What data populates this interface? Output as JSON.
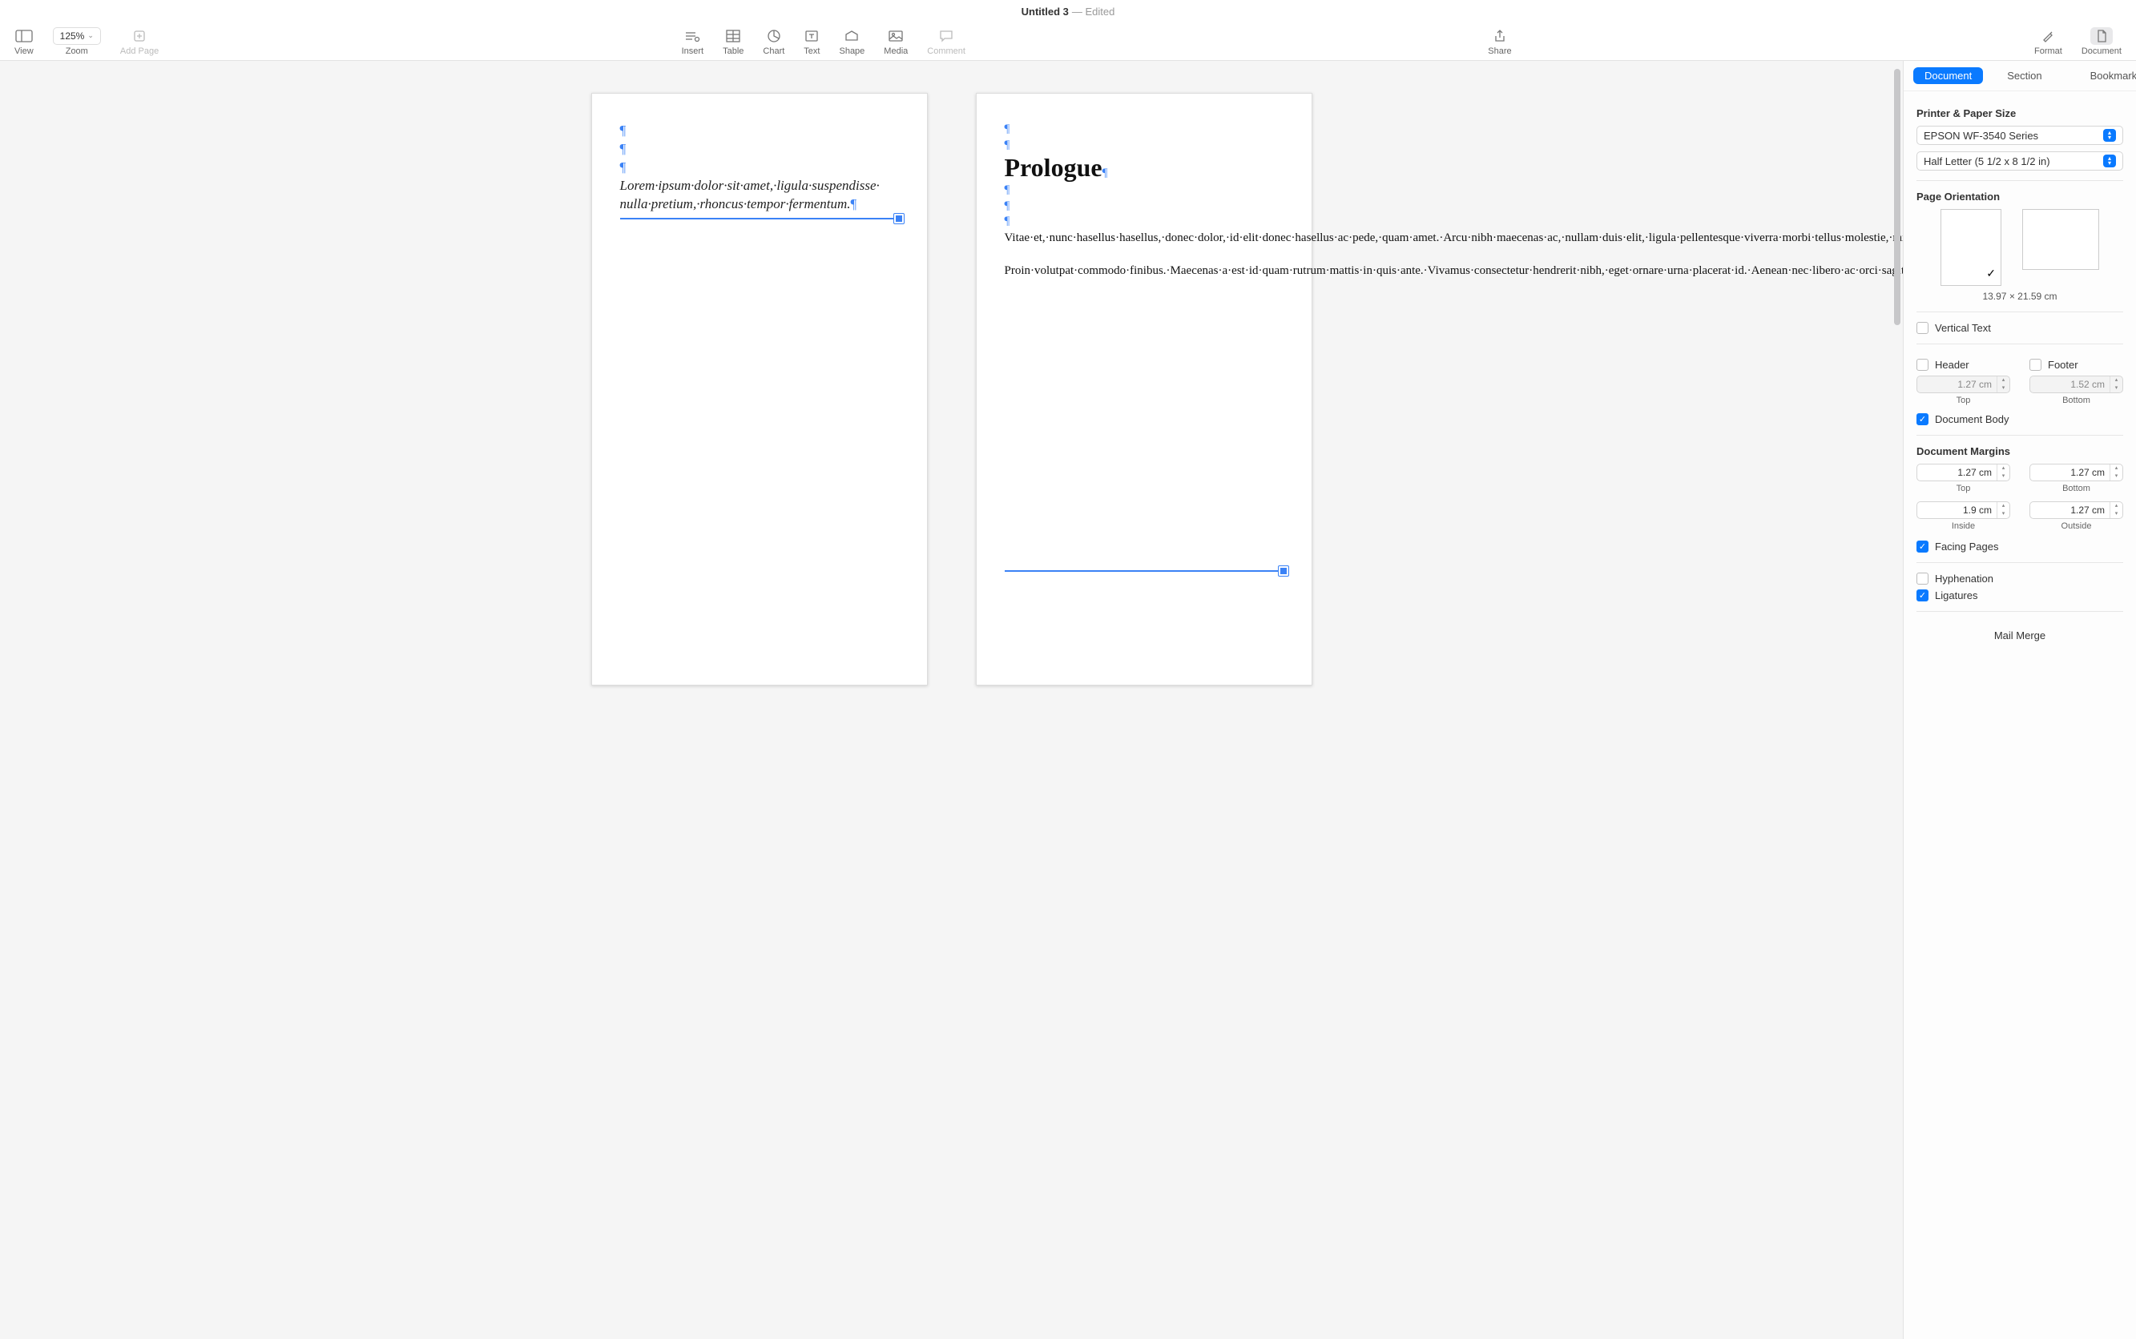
{
  "titlebar": {
    "title": "Untitled 3",
    "edited": "— Edited"
  },
  "toolbar": {
    "view": "View",
    "zoom_value": "125%",
    "zoom": "Zoom",
    "add_page": "Add Page",
    "insert": "Insert",
    "table": "Table",
    "chart": "Chart",
    "text": "Text",
    "shape": "Shape",
    "media": "Media",
    "comment": "Comment",
    "share": "Share",
    "format": "Format",
    "document": "Document"
  },
  "doc": {
    "page1": "Lorem·ipsum·dolor·sit·amet,·ligula·suspendisse·\nnulla·pretium,·rhoncus·tempor·fermentum.",
    "page2_heading": "Prologue",
    "page2_body1": "Vitae·et,·nunc·hasellus·hasellus,·donec·dolor,·id·elit·donec·hasellus·ac·pede,·quam·amet.·Arcu·nibh·maecenas·ac,·nullam·duis·elit,·ligula·pellentesque·viverra·morbi·tellus·molestie,·mi.·Sodales·nunc·suscipit·sit·pretium·aliquet·integer,·consectetuer·pede,·et·risus·hac·diam·at,·commodo·in.·Scelerisque·sodales,·mauris·lorem·non·consectetuer.·Felis·maecenas·sit·adipiscing·elit·ullamcorper·non,·amet·pede·consectetuer·quis·rutrum·sit,·nec·vestibulum·sem,·integer·non·felis·a·vel.·Vel·proin,·sapien·sit,·mauris·amet·in·semper·dolor.·Lacus·non·pariatur·et·dolor.·Risus·mattis.·Eu·tristique·erat·a,·morbi·vel.·Tempor·quis·elit·ac·maxime·et.·Amet·mauris·nec·voluptatum,·habitant·tellus·dignissim·sed·eros,·justo·fames.",
    "page2_body2": "Proin·volutpat·commodo·finibus.·Maecenas·a·est·id·quam·rutrum·mattis·in·quis·ante.·Vivamus·consectetur·hendrerit·nibh,·eget·ornare·urna·placerat·id.·Aenean·nec·libero·ac·orci·sagittis·ultrices·vitae·eu·enim.·Integer·tempor."
  },
  "inspector": {
    "tab_document": "Document",
    "tab_section": "Section",
    "tab_bookmarks": "Bookmarks",
    "printer_title": "Printer & Paper Size",
    "printer": "EPSON WF-3540 Series",
    "paper": "Half Letter (5 1/2 x 8 1/2 in)",
    "orient_title": "Page Orientation",
    "orient_caption": "13.97 × 21.59 cm",
    "vertical_text": "Vertical Text",
    "header": "Header",
    "footer": "Footer",
    "header_val": "1.27 cm",
    "footer_val": "1.52 cm",
    "top": "Top",
    "bottom": "Bottom",
    "doc_body": "Document Body",
    "margins_title": "Document Margins",
    "m_top": "1.27 cm",
    "m_bottom": "1.27 cm",
    "m_inside": "1.9 cm",
    "m_outside": "1.27 cm",
    "cap_top": "Top",
    "cap_bottom": "Bottom",
    "cap_inside": "Inside",
    "cap_outside": "Outside",
    "facing": "Facing Pages",
    "hyphenation": "Hyphenation",
    "ligatures": "Ligatures",
    "mailmerge": "Mail Merge"
  }
}
